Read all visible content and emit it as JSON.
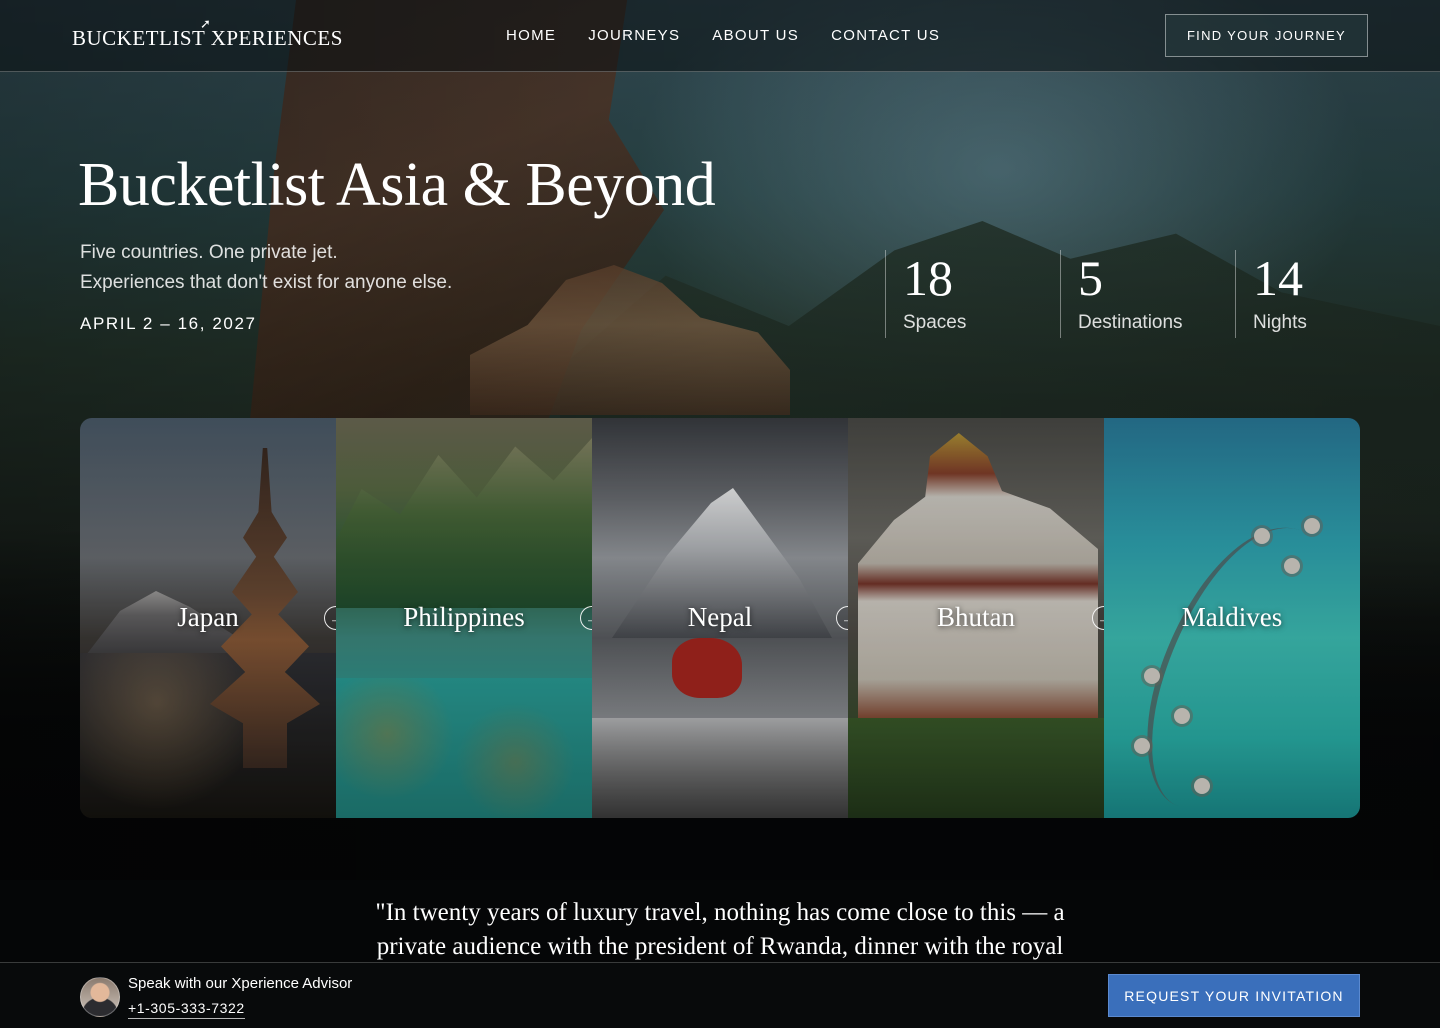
{
  "header": {
    "logo": "BUCKETLIST XPERIENCES",
    "nav": [
      "HOME",
      "JOURNEYS",
      "ABOUT US",
      "CONTACT US"
    ],
    "cta": "FIND YOUR JOURNEY"
  },
  "hero": {
    "title": "Bucketlist Asia & Beyond",
    "subtitle_line1": "Five countries. One private jet.",
    "subtitle_line2": "Experiences that don't exist for anyone else.",
    "dates": "APRIL 2 – 16, 2027",
    "stats": [
      {
        "value": "18",
        "label": "Spaces"
      },
      {
        "value": "5",
        "label": "Destinations"
      },
      {
        "value": "14",
        "label": "Nights"
      }
    ]
  },
  "destinations": [
    {
      "name": "Japan",
      "arrow_icon": "arrow-circle-right-icon"
    },
    {
      "name": "Philippines",
      "arrow_icon": "arrow-circle-right-icon"
    },
    {
      "name": "Nepal",
      "arrow_icon": "arrow-circle-right-icon"
    },
    {
      "name": "Bhutan",
      "arrow_icon": "arrow-circle-right-icon"
    },
    {
      "name": "Maldives"
    }
  ],
  "quote": {
    "line1": "\"In twenty years of luxury travel, nothing has come close to this — a",
    "line2": "private audience with the president of Rwanda, dinner with the royal"
  },
  "bottom_bar": {
    "advisor_title": "Speak with our Xperience Advisor",
    "advisor_phone": "+1-305-333-7322",
    "cta": "REQUEST YOUR INVITATION"
  },
  "colors": {
    "accent_button": "#3a6fbb",
    "background": "#050607"
  }
}
